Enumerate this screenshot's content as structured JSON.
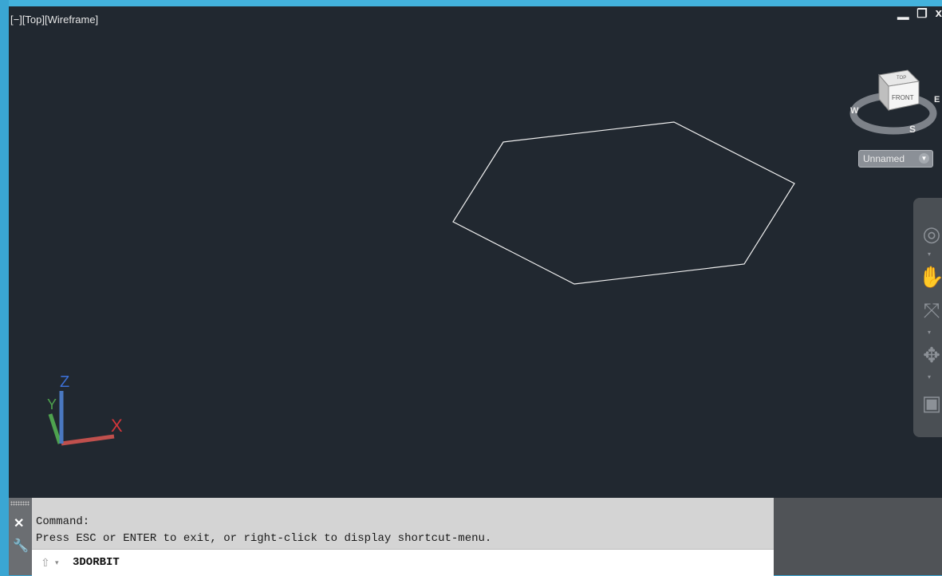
{
  "viewport": {
    "label": "[−][Top][Wireframe]",
    "background": "#212830",
    "controls": {
      "minimize": "‒",
      "restore": "❐",
      "close": "x"
    }
  },
  "viewcube": {
    "top_face": "TOP",
    "front_face": "FRONT",
    "compass": {
      "west": "W",
      "east": "E",
      "south": "S"
    }
  },
  "named_view": {
    "value": "Unnamed"
  },
  "navigation_bar": {
    "icons": [
      "steering-wheel-icon",
      "pan-icon",
      "zoom-extents-icon",
      "orbit-icon",
      "showmotion-icon"
    ]
  },
  "ucs": {
    "x": "X",
    "y": "Y",
    "z": "Z",
    "colors": {
      "x": "#c0504d",
      "y": "#4ea24e",
      "z": "#4a78c0"
    }
  },
  "command": {
    "history": [
      "Command:",
      "Press ESC or ENTER to exit, or right-click to display shortcut-menu."
    ],
    "current": "3DORBIT"
  }
}
